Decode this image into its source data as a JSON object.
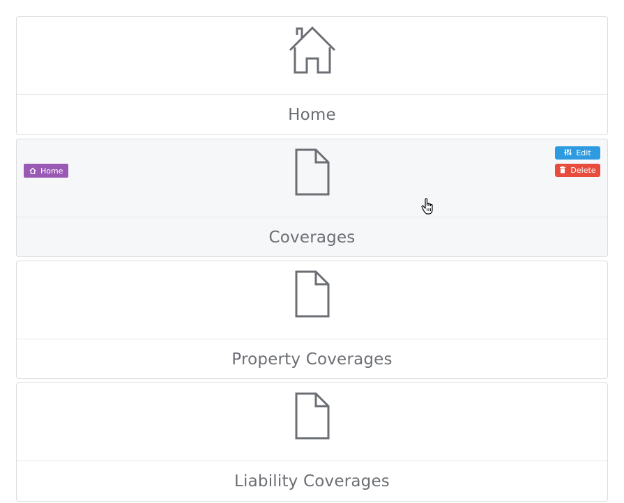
{
  "cards": [
    {
      "title": "Home",
      "icon": "house-icon"
    },
    {
      "title": "Coverages",
      "icon": "document-icon",
      "hovered": true,
      "badge": {
        "label": "Home",
        "icon": "house-icon",
        "color": "#9b59b6"
      },
      "actions": {
        "edit_label": "Edit",
        "edit_icon": "sliders-icon",
        "edit_color": "#2e9be0",
        "delete_label": "Delete",
        "delete_icon": "trash-icon",
        "delete_color": "#e74c3c"
      }
    },
    {
      "title": "Property Coverages",
      "icon": "document-icon"
    },
    {
      "title": "Liability Coverages",
      "icon": "document-icon"
    }
  ],
  "colors": {
    "card_border": "#dcdcdc",
    "title_text": "#6b6e73",
    "icon_stroke": "#6b6e73",
    "hover_background": "#f6f7f9"
  }
}
